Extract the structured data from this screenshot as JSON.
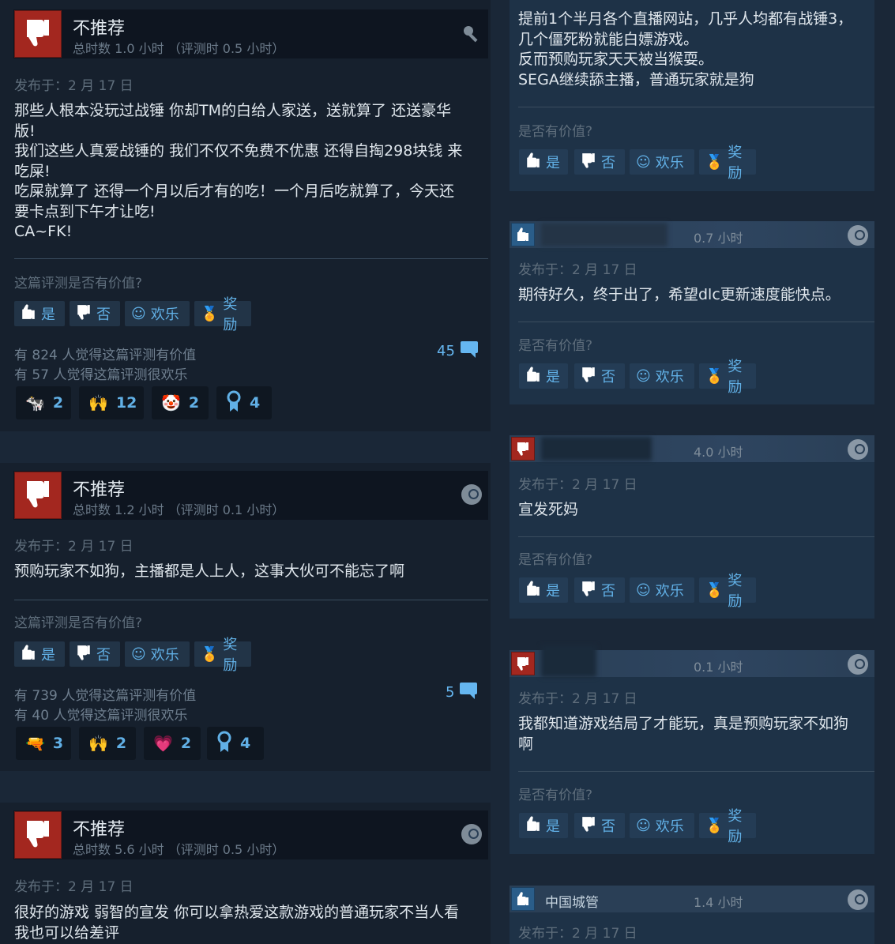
{
  "common": {
    "helpful_q": "这篇评测是否有价值?",
    "helpful_q_short": "是否有价值?",
    "yes": "是",
    "no": "否",
    "funny": "欢乐",
    "award": "奖励",
    "not_recommended": "不推荐"
  },
  "left_reviews": [
    {
      "hours": "总时数 1.0 小时 （评测时 0.5 小时）",
      "date": "发布于：2 月 17 日",
      "text": "那些人根本没玩过战锤 你却TM的白给人家送，送就算了 还送豪华\n版!\n我们这些人真爱战锤的 我们不仅不免费不优惠 还得自掏298块钱 来\n吃屎!\n吃屎就算了 还得一个月以后才有的吃！一个月后吃就算了，今天还\n要卡点到下午才让吃!\nCA~FK!",
      "helpful_count": "有 824 人觉得这篇评测有价值",
      "funny_count": "有 57 人觉得这篇评测很欢乐",
      "comments": "45",
      "awards": [
        "2",
        "12",
        "2",
        "4"
      ]
    },
    {
      "hours": "总时数 1.2 小时 （评测时 0.1 小时）",
      "date": "发布于：2 月 17 日",
      "text": "预购玩家不如狗，主播都是人上人，这事大伙可不能忘了啊",
      "helpful_count": "有 739 人觉得这篇评测有价值",
      "funny_count": "有 40 人觉得这篇评测很欢乐",
      "comments": "5",
      "awards": [
        "3",
        "2",
        "2",
        "4"
      ]
    },
    {
      "hours": "总时数 5.6 小时 （评测时 0.5 小时）",
      "date": "发布于：2 月 17 日",
      "text": "很好的游戏 弱智的宣发 你可以拿热爱这款游戏的普通玩家不当人看\n我也可以给差评"
    }
  ],
  "right_top_text": "提前1个半月各个直播网站，几乎人均都有战锤3，\n几个僵死粉就能白嫖游戏。\n反而预购玩家天天被当猴耍。\nSEGA继续舔主播，普通玩家就是狗",
  "right_reviews": [
    {
      "hours": "0.7 小时",
      "date": "发布于：2 月 17 日",
      "text": "期待好久，终于出了，希望dlc更新速度能快点。",
      "name": ""
    },
    {
      "hours": "4.0 小时",
      "date": "发布于：2 月 17 日",
      "text": "宣发死妈",
      "name": ""
    },
    {
      "hours": "0.1 小时",
      "date": "发布于：2 月 17 日",
      "text": "我都知道游戏结局了才能玩，真是预购玩家不如狗\n啊",
      "name": ""
    },
    {
      "hours": "1.4 小时",
      "date": "发布于：2 月 17 日",
      "name": "中国城管"
    }
  ],
  "colors": {
    "page_bg": "#1a2737",
    "card_bg": "#16202d",
    "right_card_bg": "#1e3247",
    "thumb_down": "#a3271f",
    "thumb_up": "#2a5d89",
    "link_blue": "#61b0e6"
  }
}
